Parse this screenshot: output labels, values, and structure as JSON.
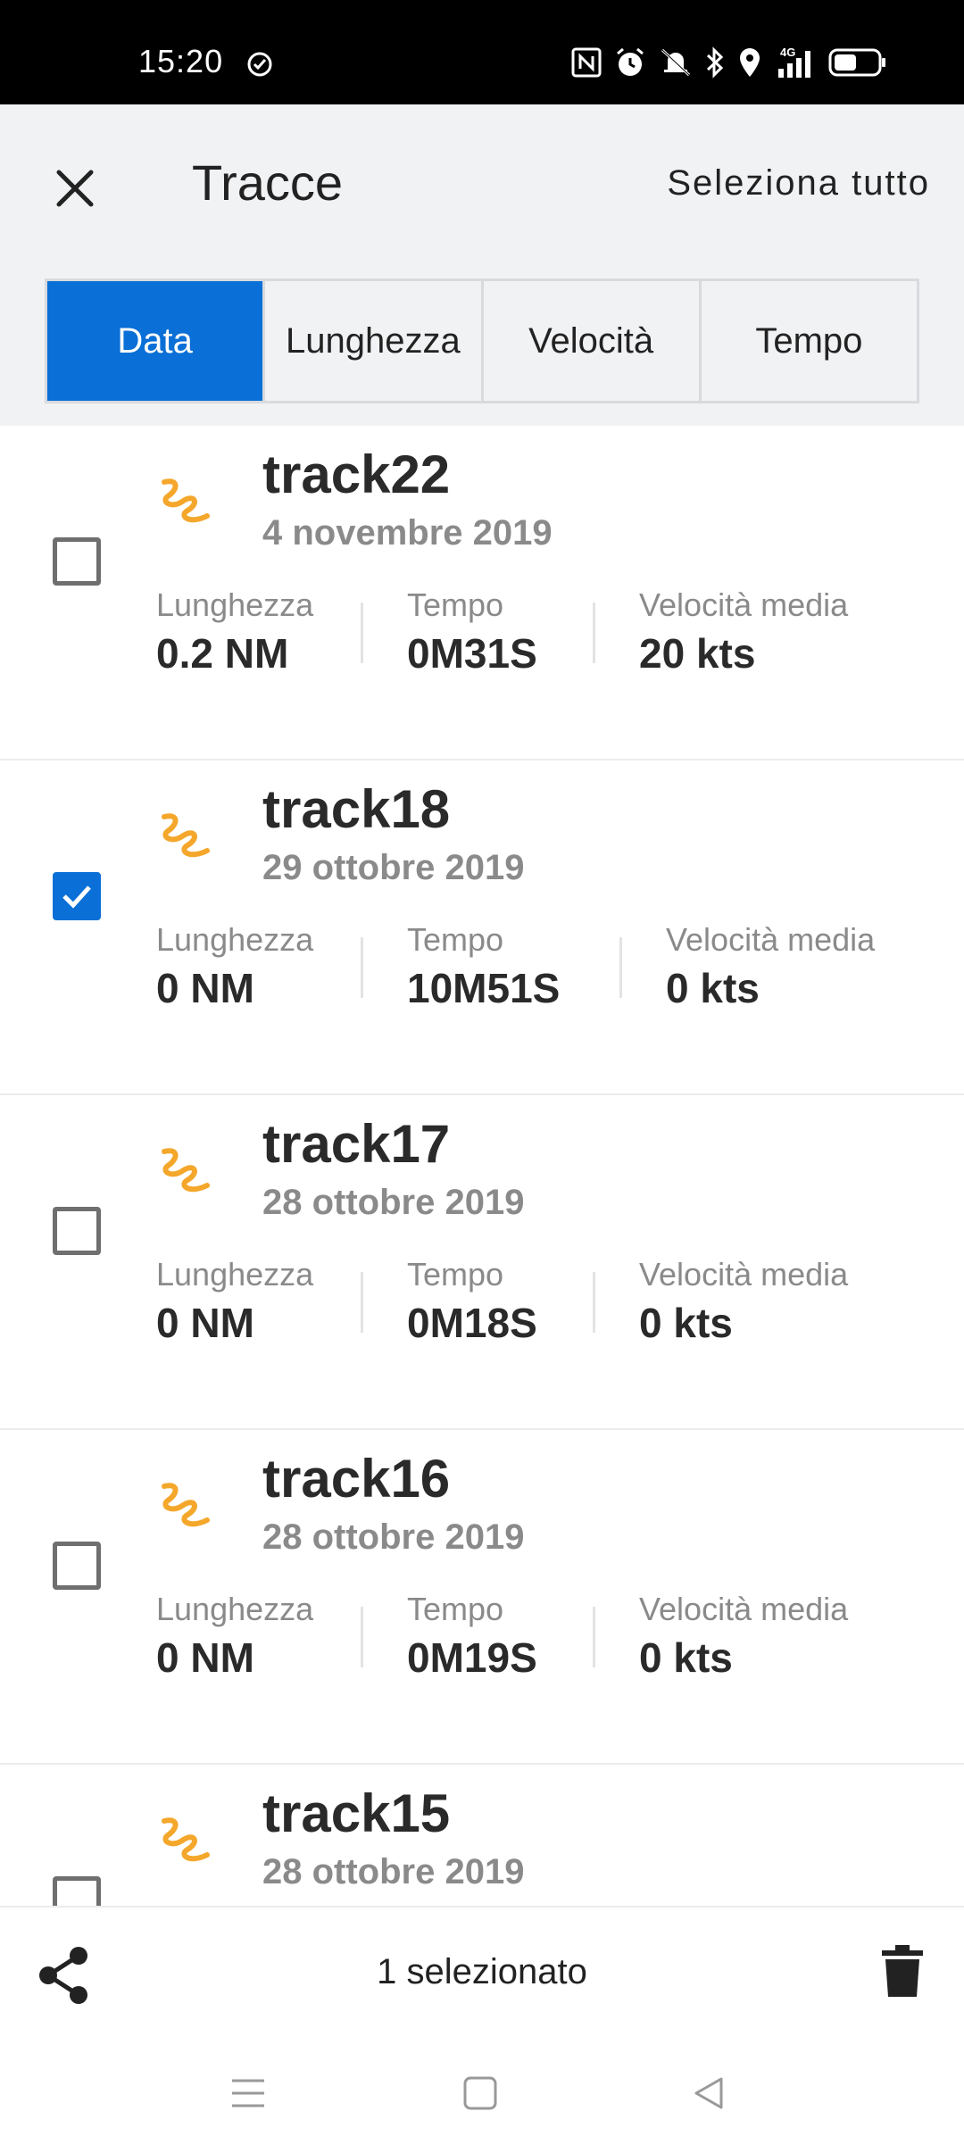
{
  "status_bar": {
    "time": "15:20",
    "icons": [
      "sync-check-icon",
      "nfc-icon",
      "alarm-icon",
      "mute-icon",
      "bluetooth-icon",
      "location-icon",
      "signal-4g-icon",
      "battery-icon"
    ],
    "network_label": "4G"
  },
  "header": {
    "title": "Tracce",
    "select_all_label": "Seleziona tutto",
    "close_icon": "close-icon"
  },
  "tabs": [
    {
      "label": "Data",
      "active": true
    },
    {
      "label": "Lunghezza",
      "active": false
    },
    {
      "label": "Velocità",
      "active": false
    },
    {
      "label": "Tempo",
      "active": false
    }
  ],
  "colors": {
    "accent": "#0a6fd6",
    "track_icon": "#f4a72b",
    "header_bg": "#f1f2f4"
  },
  "stat_labels": {
    "length": "Lunghezza",
    "time": "Tempo",
    "avg_speed": "Velocità media"
  },
  "tracks": [
    {
      "name": "track22",
      "date": "4 novembre 2019",
      "length": "0.2 NM",
      "time": "0M31S",
      "speed": "20 kts",
      "checked": false
    },
    {
      "name": "track18",
      "date": "29 ottobre 2019",
      "length": "0 NM",
      "time": "10M51S",
      "speed": "0 kts",
      "checked": true
    },
    {
      "name": "track17",
      "date": "28 ottobre 2019",
      "length": "0 NM",
      "time": "0M18S",
      "speed": "0 kts",
      "checked": false
    },
    {
      "name": "track16",
      "date": "28 ottobre 2019",
      "length": "0 NM",
      "time": "0M19S",
      "speed": "0 kts",
      "checked": false
    },
    {
      "name": "track15",
      "date": "28 ottobre 2019",
      "checked": false
    }
  ],
  "action_bar": {
    "selected_count_label": "1 selezionato",
    "share_icon": "share-icon",
    "delete_icon": "trash-icon"
  },
  "nav_bar": {
    "icons": [
      "menu-icon",
      "home-icon",
      "back-icon"
    ]
  }
}
